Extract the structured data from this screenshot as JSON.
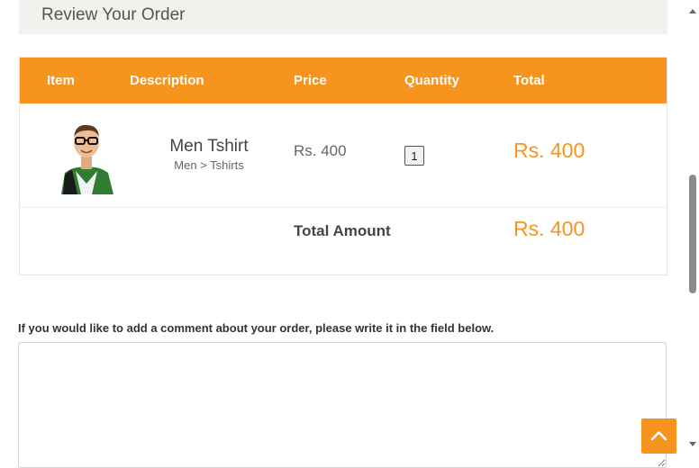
{
  "header": {
    "title": "Review Your Order"
  },
  "table": {
    "columns": [
      "Item",
      "Description",
      "Price",
      "Quantity",
      "Total"
    ],
    "rows": [
      {
        "image_icon": "man-in-tshirt-photo",
        "name": "Men Tshirt",
        "category": "Men > Tshirts",
        "price": "Rs. 400",
        "quantity": "1",
        "total": "Rs. 400"
      }
    ],
    "total_label": "Total Amount",
    "total_amount": "Rs. 400"
  },
  "comment": {
    "label": "If you would like to add a comment about your order, please write it in the field below.",
    "value": ""
  },
  "colors": {
    "accent": "#f7941d",
    "header_bg": "#f1f1ee"
  },
  "back_to_top_icon": "chevron-up-icon"
}
